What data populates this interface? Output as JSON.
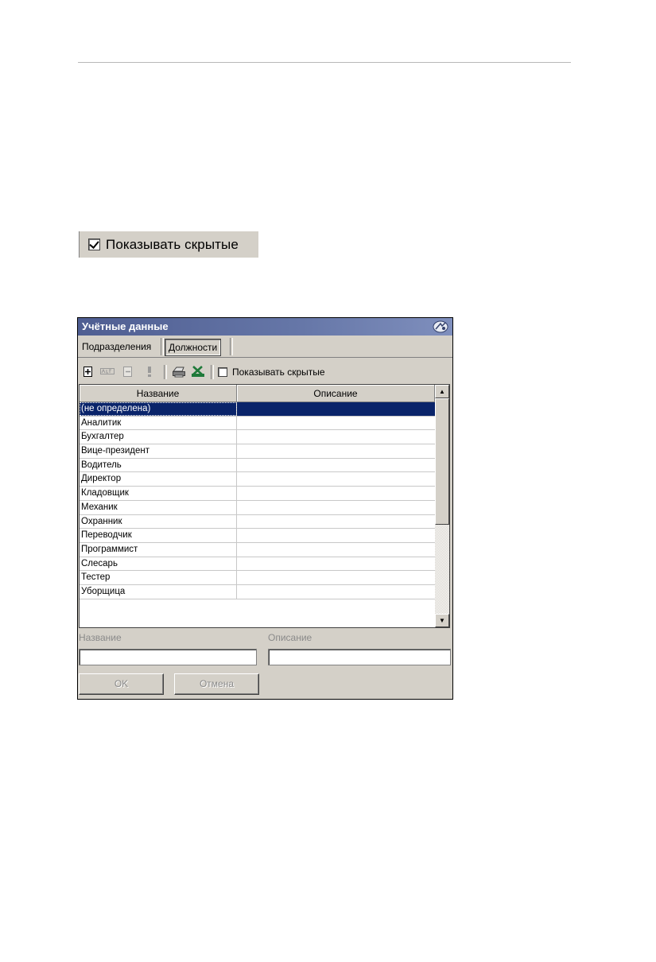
{
  "snippet": {
    "checkbox_label": "Показывать скрытые",
    "checked": true
  },
  "window": {
    "title": "Учётные данные",
    "tabs": [
      {
        "label": "Подразделения"
      },
      {
        "label": "Должности",
        "active": true
      }
    ],
    "toolbar": {
      "icons": [
        "add-icon",
        "rename-icon",
        "delete-icon",
        "warning-icon",
        "print-icon",
        "excel-export-icon"
      ],
      "show_hidden_label": "Показывать скрытые"
    },
    "grid": {
      "columns": [
        "Название",
        "Описание"
      ],
      "rows": [
        {
          "name": "(не определена)",
          "description": "",
          "selected": true
        },
        {
          "name": "Аналитик",
          "description": ""
        },
        {
          "name": "Бухгалтер",
          "description": ""
        },
        {
          "name": "Вице-президент",
          "description": ""
        },
        {
          "name": "Водитель",
          "description": ""
        },
        {
          "name": "Директор",
          "description": ""
        },
        {
          "name": "Кладовщик",
          "description": ""
        },
        {
          "name": "Механик",
          "description": ""
        },
        {
          "name": "Охранник",
          "description": ""
        },
        {
          "name": "Переводчик",
          "description": ""
        },
        {
          "name": "Программист",
          "description": ""
        },
        {
          "name": "Слесарь",
          "description": ""
        },
        {
          "name": "Тестер",
          "description": ""
        },
        {
          "name": "Уборщица",
          "description": ""
        }
      ]
    },
    "form": {
      "name_label": "Название",
      "description_label": "Описание",
      "name_value": "",
      "description_value": "",
      "ok_label": "OK",
      "cancel_label": "Отмена"
    }
  }
}
